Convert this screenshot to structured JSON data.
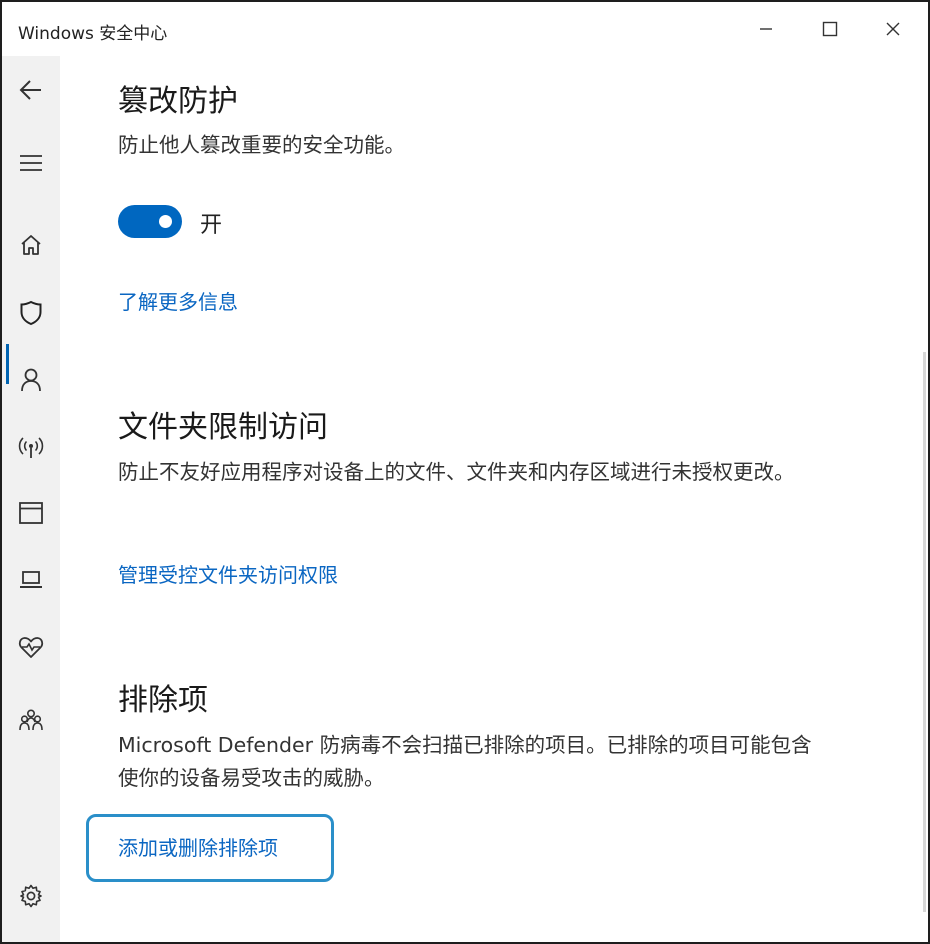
{
  "window": {
    "title": "Windows 安全中心"
  },
  "sidebar": {
    "items": [
      {
        "icon": "back-arrow-icon"
      },
      {
        "icon": "hamburger-menu-icon"
      },
      {
        "icon": "home-icon"
      },
      {
        "icon": "shield-icon",
        "active": true
      },
      {
        "icon": "person-icon"
      },
      {
        "icon": "wifi-antenna-icon"
      },
      {
        "icon": "app-browser-icon"
      },
      {
        "icon": "laptop-icon"
      },
      {
        "icon": "heart-pulse-icon"
      },
      {
        "icon": "family-icon"
      },
      {
        "icon": "gear-icon"
      }
    ]
  },
  "sections": {
    "tamper": {
      "title": "篡改防护",
      "desc": "防止他人篡改重要的安全功能。",
      "toggle_state": "开",
      "toggle_on": true,
      "link": "了解更多信息"
    },
    "folder": {
      "title": "文件夹限制访问",
      "desc": "防止不友好应用程序对设备上的文件、文件夹和内存区域进行未授权更改。",
      "link": "管理受控文件夹访问权限"
    },
    "exclusions": {
      "title": "排除项",
      "desc": "Microsoft Defender 防病毒不会扫描已排除的项目。已排除的项目可能包含使你的设备易受攻击的威胁。",
      "link": "添加或删除排除项"
    }
  },
  "colors": {
    "accent": "#0067c0",
    "link": "#0a66c2",
    "focus": "#2a8fc9",
    "sidebar": "#f1f1f1"
  }
}
